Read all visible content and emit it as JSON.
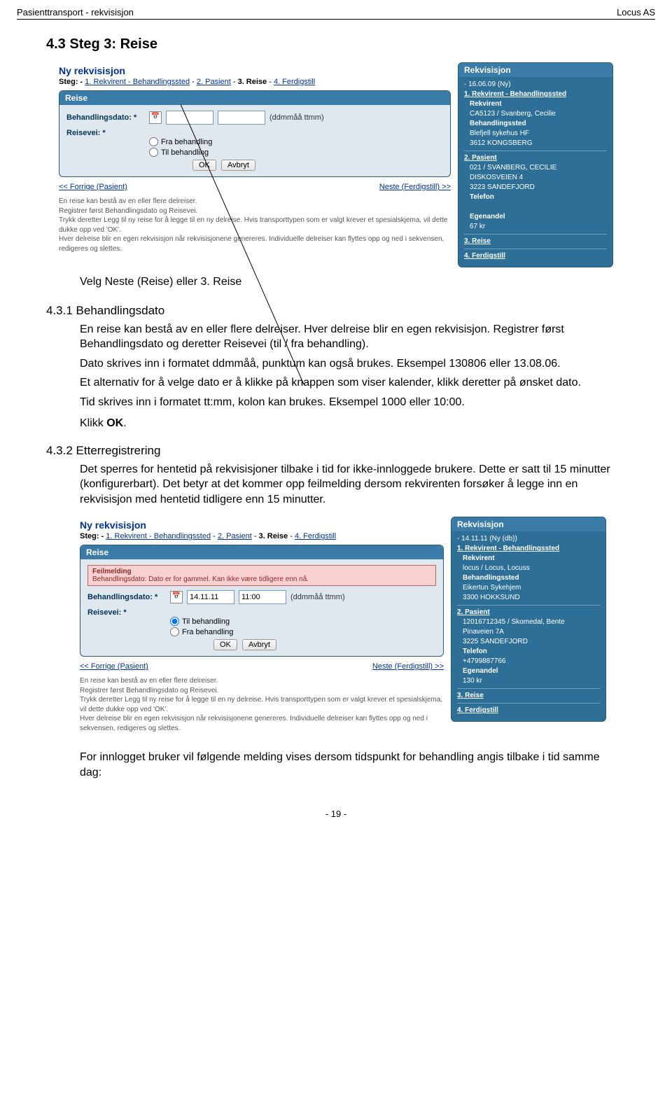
{
  "header": {
    "left": "Pasienttransport - rekvisisjon",
    "right": "Locus AS"
  },
  "section_title": "4.3   Steg 3: Reise",
  "intro_line": "Velg Neste (Reise) eller 3. Reise",
  "sub_431": "4.3.1   Behandlingsdato",
  "p1": "En reise kan bestå av en eller flere delreiser. Hver delreise blir en egen rekvisisjon. Registrer først Behandlingsdato og deretter Reisevei (til / fra behandling).",
  "p2": "Dato skrives inn i formatet ddmmåå, punktum kan også brukes. Eksempel 130806 eller 13.08.06.",
  "p3": "Et alternativ for å velge dato er å klikke på knappen som viser kalender, klikk deretter på ønsket dato.",
  "p4": "Tid skrives inn i formatet tt:mm, kolon kan brukes. Eksempel 1000 eller 10:00.",
  "klikk_ok": "Klikk OK.",
  "sub_432": "4.3.2   Etterregistrering",
  "p5": "Det sperres for hentetid på rekvisisjoner tilbake i tid for ikke-innloggede brukere. Dette er satt til 15 minutter (konfigurerbart). Det betyr at det kommer opp feilmelding dersom rekvirenten forsøker å legge inn en rekvisisjon med hentetid tidligere enn 15 minutter.",
  "p6": "For innlogget bruker vil følgende melding vises dersom tidspunkt for behandling angis tilbake i tid samme dag:",
  "app1": {
    "title": "Ny rekvisisjon",
    "steps_prefix": "Steg: - ",
    "s1": "1. Rekvirent - Behandlingssted",
    "s2": "2. Pasient",
    "s3": "3. Reise",
    "s4": "4. Ferdigstill",
    "panel_title": "Reise",
    "f_date": "Behandlingsdato: *",
    "f_travel": "Reisevei: *",
    "hint": "(ddmmåå ttmm)",
    "r1": "Fra behandling",
    "r2": "Til behandling",
    "btn_ok": "OK",
    "btn_cancel": "Avbryt",
    "prev": "<< Forrige (Pasient)",
    "next": "Neste (Ferdigstill) >>",
    "foot": "En reise kan bestå av en eller flere delreiser.\nRegistrer først Behandlingsdato og Reisevei.\nTrykk deretter Legg til ny reise for å legge til en ny delreise. Hvis transporttypen som er valgt krever et spesialskjema, vil dette dukke opp ved 'OK'.\nHver delreise blir en egen rekvisisjon når rekvisisjonene genereres. Individuelle delreiser kan flyttes opp og ned i sekvensen, redigeres og slettes.",
    "sidebar": {
      "title": "Rekvisisjon",
      "date": "- 16.06.09 (Ny)",
      "s1": "1. Rekvirent - Behandlingssted",
      "rek": "Rekvirent",
      "rek_v": "CA5123 / Svanberg, Cecilie",
      "beh": "Behandlingssted",
      "beh_v1": "Blefjell sykehus HF",
      "beh_v2": "3612 KONGSBERG",
      "s2": "2. Pasient",
      "pat": "021           / SVANBERG, CECILIE",
      "pat_addr": "DISKOSVEIEN 4",
      "pat_city": "3223 SANDEFJORD",
      "tel": "Telefon",
      "eg": "Egenandel",
      "eg_v": "67 kr",
      "s3": "3. Reise",
      "s4": "4. Ferdigstill"
    }
  },
  "app2": {
    "title": "Ny rekvisisjon",
    "steps_prefix": "Steg: - ",
    "s1": "1. Rekvirent - Behandlingssted",
    "s2": "2. Pasient",
    "s3": "3. Reise",
    "s4": "4. Ferdigstill",
    "panel_title": "Reise",
    "err_title": "Feilmelding",
    "err_msg": "Behandlingsdato: Dato er for gammel. Kan ikke være tidligere enn nå.",
    "f_date": "Behandlingsdato: *",
    "date_val": "14.11.11",
    "time_val": "11:00",
    "hint": "(ddmmåå ttmm)",
    "f_travel": "Reisevei: *",
    "r1": "Til behandling",
    "r2": "Fra behandling",
    "btn_ok": "OK",
    "btn_cancel": "Avbryt",
    "prev": "<< Forrige (Pasient)",
    "next": "Neste (Ferdigstill) >>",
    "foot": "En reise kan bestå av en eller flere delreiser.\nRegistrer først Behandlingsdato og Reisevei.\nTrykk deretter Legg til ny reise for å legge til en ny delreise. Hvis transporttypen som er valgt krever et spesialskjema, vil dette dukke opp ved 'OK'.\nHver delreise blir en egen rekvisisjon når rekvisisjonene genereres. Individuelle delreiser kan flyttes opp og ned i sekvensen, redigeres og slettes.",
    "sidebar": {
      "title": "Rekvisisjon",
      "date": "- 14.11.11 (Ny (db))",
      "s1": "1. Rekvirent - Behandlingssted",
      "rek": "Rekvirent",
      "rek_v": "locus / Locus, Locuss",
      "beh": "Behandlingssted",
      "beh_v1": "Eikertun Sykehjem",
      "beh_v2": "3300 HOKKSUND",
      "s2": "2. Pasient",
      "pat": "12016712345 / Skomedal, Bente",
      "pat_addr": "Pinaveien 7A",
      "pat_city": "3225 SANDEFJORD",
      "tel": "Telefon",
      "tel_v": "+4799887766",
      "eg": "Egenandel",
      "eg_v": "130 kr",
      "s3": "3. Reise",
      "s4": "4. Ferdigstill"
    }
  },
  "footer": "- 19 -"
}
